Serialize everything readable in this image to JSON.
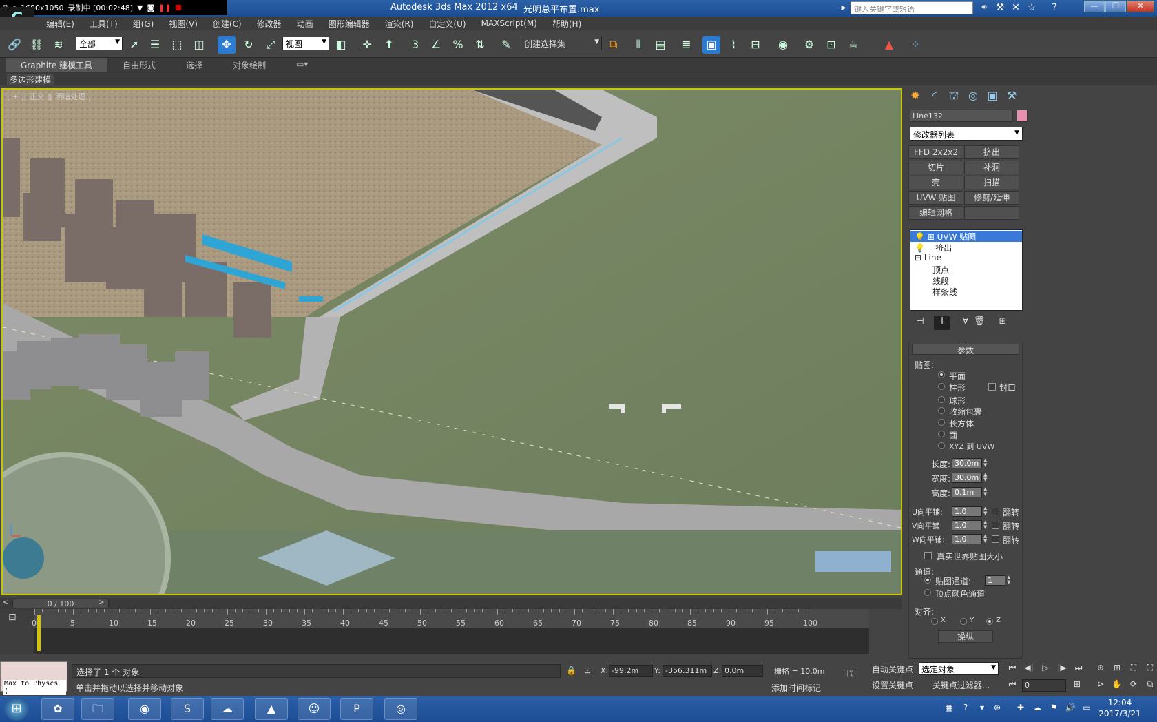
{
  "recorder": {
    "resolution": "1680x1050",
    "status": "录制中 [00:02:48]"
  },
  "app": {
    "title": "Autodesk 3ds Max  2012 x64",
    "document": "光明总平布置.max",
    "logo": "G",
    "search_placeholder": "键入关键字或短语"
  },
  "menu": [
    "编辑(E)",
    "工具(T)",
    "组(G)",
    "视图(V)",
    "创建(C)",
    "修改器",
    "动画",
    "图形编辑器",
    "渲染(R)",
    "自定义(U)",
    "MAXScript(M)",
    "帮助(H)"
  ],
  "toolbar": {
    "filter": "全部",
    "refcoord": "视图",
    "selset": "创建选择集",
    "snap3": "3",
    "pct": "%"
  },
  "ribbon": {
    "tabs": [
      "Graphite 建模工具",
      "自由形式",
      "选择",
      "对象绘制"
    ],
    "sub": "多边形建模"
  },
  "viewport": {
    "label": "[ + ][ 正交 ][ 明暗处理 ]"
  },
  "panel": {
    "object_name": "Line132",
    "object_color": "#e890b0",
    "modifier_list": "修改器列表",
    "buttons": [
      [
        "FFD 2x2x2",
        "挤出"
      ],
      [
        "切片",
        "补洞"
      ],
      [
        "壳",
        "扫描"
      ],
      [
        "UVW 贴图",
        "修剪/延伸"
      ],
      [
        "编辑网格",
        ""
      ]
    ],
    "stack": [
      {
        "label": "UVW 贴图",
        "selected": true
      },
      {
        "label": "挤出",
        "selected": false
      },
      {
        "label": "Line",
        "selected": false
      },
      {
        "label": "顶点",
        "selected": false
      },
      {
        "label": "线段",
        "selected": false
      },
      {
        "label": "样条线",
        "selected": false
      }
    ],
    "params": {
      "title": "参数",
      "mapping_label": "贴图:",
      "mapping_options": [
        "平面",
        "柱形",
        "球形",
        "收缩包裹",
        "长方体",
        "面",
        "XYZ 到 UVW"
      ],
      "cap": "封口",
      "length_label": "长度:",
      "length": "30.0m",
      "width_label": "宽度:",
      "width": "30.0m",
      "height_label": "高度:",
      "height": "0.1m",
      "utile_label": "U向平铺:",
      "utile": "1.0",
      "vtile_label": "V向平铺:",
      "vtile": "1.0",
      "wtile_label": "W向平铺:",
      "wtile": "1.0",
      "flip": "翻转",
      "realworld": "真实世界贴图大小",
      "channel_label": "通道:",
      "map_channel": "贴图通道:",
      "map_channel_value": "1",
      "vertex_color": "顶点颜色通道",
      "align_label": "对齐:",
      "axes": [
        "X",
        "Y",
        "Z"
      ],
      "manipulate": "操纵"
    }
  },
  "time": {
    "position": "0 / 100",
    "ticks": [
      "0",
      "5",
      "10",
      "15",
      "20",
      "25",
      "30",
      "35",
      "40",
      "45",
      "50",
      "55",
      "60",
      "65",
      "70",
      "75",
      "80",
      "85",
      "90",
      "95",
      "100"
    ]
  },
  "status": {
    "maxphys": "Max to Physcs (",
    "selected": "选择了 1 个 对象",
    "hint": "单击并拖动以选择并移动对象",
    "x_label": "X:",
    "x": "-99.2m",
    "y_label": "Y:",
    "y": "-356.311m",
    "z_label": "Z:",
    "z": "0.0m",
    "grid": "栅格 = 10.0m",
    "add_time_tag": "添加时间标记"
  },
  "keys": {
    "auto_key": "自动关键点",
    "set_key": "设置关键点",
    "selset": "选定对象",
    "key_filters": "关键点过滤器...",
    "frame": "0"
  },
  "taskbar": {
    "time": "12:04",
    "date": "2017/3/21"
  }
}
